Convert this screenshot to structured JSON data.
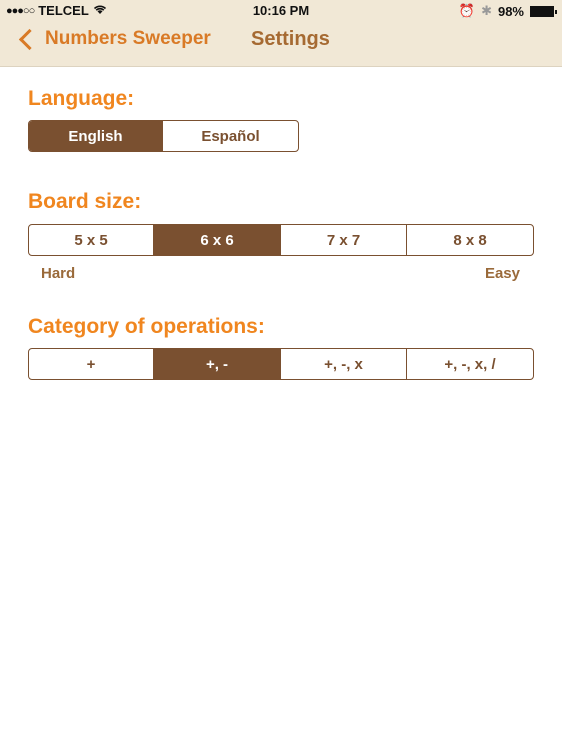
{
  "status_bar": {
    "signal": "●●●○○",
    "carrier": "TELCEL",
    "time": "10:16 PM",
    "battery": "98%"
  },
  "nav": {
    "back_label": "Numbers Sweeper",
    "title": "Settings"
  },
  "language": {
    "title": "Language:",
    "options": [
      "English",
      "Español"
    ],
    "selected": "English"
  },
  "board_size": {
    "title": "Board size:",
    "options": [
      "5 x 5",
      "6 x 6",
      "7 x 7",
      "8 x 8"
    ],
    "selected": "6 x 6",
    "hint_left": "Hard",
    "hint_right": "Easy"
  },
  "operations": {
    "title": "Category of operations:",
    "options": [
      "+",
      "+, -",
      "+, -, x",
      "+, -, x, /"
    ],
    "selected": "+, -"
  },
  "colors": {
    "accent": "#f0861f",
    "brown": "#7a5030",
    "bar": "#f1e8d6"
  }
}
